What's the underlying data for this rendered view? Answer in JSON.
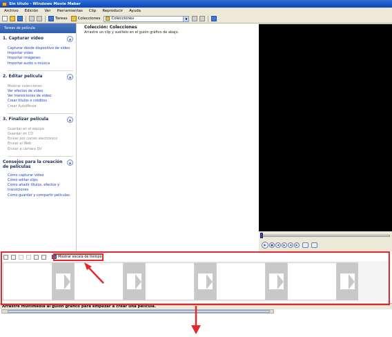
{
  "window": {
    "title": "Sin título - Windows Movie Maker"
  },
  "menu": [
    "Archivo",
    "Edición",
    "Ver",
    "Herramientas",
    "Clip",
    "Reproducir",
    "Ayuda"
  ],
  "toolbar": {
    "tasks_label": "Tareas",
    "collections_label": "Colecciones",
    "collections_dropdown_value": "Colecciones"
  },
  "taskpane": {
    "header": "Tareas de película",
    "sections": [
      {
        "title": "1. Capturar vídeo",
        "links": [
          {
            "label": "Capturar desde dispositivo de vídeo",
            "enabled": true
          },
          {
            "label": "Importar vídeo",
            "enabled": true
          },
          {
            "label": "Importar imágenes",
            "enabled": true
          },
          {
            "label": "Importar audio o música",
            "enabled": true
          }
        ]
      },
      {
        "title": "2. Editar película",
        "links": [
          {
            "label": "Mostrar colecciones",
            "enabled": false
          },
          {
            "label": "Ver efectos de vídeo",
            "enabled": true
          },
          {
            "label": "Ver transiciones de vídeo",
            "enabled": true
          },
          {
            "label": "Crear títulos o créditos",
            "enabled": true
          },
          {
            "label": "Crear AutoMovie",
            "enabled": false
          }
        ]
      },
      {
        "title": "3. Finalizar película",
        "links": [
          {
            "label": "Guardar en el equipo",
            "enabled": false
          },
          {
            "label": "Guardar en CD",
            "enabled": false
          },
          {
            "label": "Enviar por correo electrónico",
            "enabled": false
          },
          {
            "label": "Enviar al Web",
            "enabled": false
          },
          {
            "label": "Enviar a cámara DV",
            "enabled": false
          }
        ]
      },
      {
        "title": "Consejos para la creación de películas",
        "links": [
          {
            "label": "Cómo capturar vídeo",
            "enabled": true
          },
          {
            "label": "Cómo editar clips",
            "enabled": true
          },
          {
            "label": "Cómo añadir títulos, efectos y transiciones",
            "enabled": true
          },
          {
            "label": "Cómo guardar y compartir películas",
            "enabled": true
          }
        ]
      }
    ]
  },
  "collection": {
    "title": "Colección: Colecciones",
    "subtitle": "Arrastre un clip y suéltelo en el guión gráfico de abajo."
  },
  "storyboard": {
    "toggle_label": "Mostrar escala de tiempo",
    "slots": 5,
    "status": "Arrastre multimedia al guión gráfico para empezar a crear una película."
  },
  "colors": {
    "highlight": "#e5262b",
    "title_bar": "#0b47b8",
    "link": "#1a3fbf"
  }
}
